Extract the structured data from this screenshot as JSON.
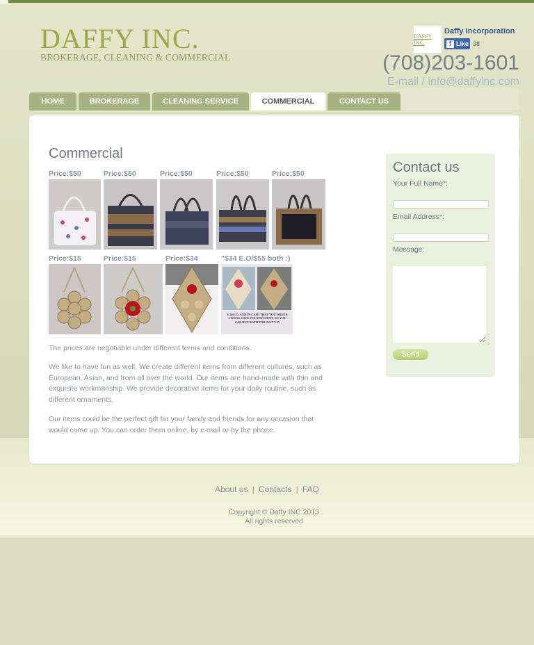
{
  "brand": {
    "name": "DAFFY INC.",
    "tagline": "BROKERAGE, CLEANING & COMMERCIAL",
    "color": "#9aa94a"
  },
  "facebook": {
    "thumb_text": "DAFFY INC.",
    "page_name": "Daffy Incorporation",
    "like_label": "Like",
    "like_count": "38"
  },
  "contact_info": {
    "phone": "(708)203-1601",
    "email": "E-mail / info@daffyinc.com"
  },
  "nav": {
    "items": [
      {
        "label": "HOME"
      },
      {
        "label": "BROKERAGE"
      },
      {
        "label": "CLEANING SERVICE"
      },
      {
        "label": "COMMERCIAL"
      },
      {
        "label": "CONTACT US"
      }
    ],
    "active": "COMMERCIAL"
  },
  "main": {
    "title": "Commercial",
    "row1": [
      {
        "price": "Price:$50",
        "image": "white floral handbag"
      },
      {
        "price": "Price:$50",
        "image": "fringed handbag with beads"
      },
      {
        "price": "Price:$50",
        "image": "dark fringed handbag"
      },
      {
        "price": "Price:$50",
        "image": "striped fringed handbag"
      },
      {
        "price": "Price:$50",
        "image": "black fringed handbag"
      }
    ],
    "row2": [
      {
        "price": "Price:$15",
        "image": "woven wall ornament"
      },
      {
        "price": "Price:$15",
        "image": "woven wall ornament with red flower"
      },
      {
        "price": "Price:$34",
        "image": "diamond woven ornament with red flower"
      },
      {
        "price": "\"$34 E.O/$55 both :)",
        "image": "two diamond ornaments",
        "caption": "$ 34/E.O. AND IN CASE THAT YOU ORDER 2 WE'LL GIVE YOU DISCOUNT, SO YOU CAN BUY BOTH FOR JUST $ 55"
      }
    ],
    "paragraphs": [
      "The prices are negotiable under different terms and conditions.",
      "We like to have fun as well. We create different items from different cultures, such as European, Asian, and from all over the world. Our items are hand-made with thin and exquisite workmanship. We provide decorative items for your daily routine, such as different ornaments.",
      "Our items could be the perfect gift for your family and friends for any occasion that would come up. You can order them online, by e-mail or by the phone."
    ]
  },
  "contact_form": {
    "title": "Contact us",
    "name_label": "Your Full Name*:",
    "name_value": "",
    "email_label": "Email Address*:",
    "email_value": "",
    "message_label": "Message:",
    "message_value": "",
    "send_label": "Send"
  },
  "footer": {
    "links": [
      "About us",
      "Contacts",
      "FAQ"
    ],
    "separator": "|",
    "copyright": "Copyright © Daffy INC 2013",
    "rights": "All rights reserved"
  }
}
